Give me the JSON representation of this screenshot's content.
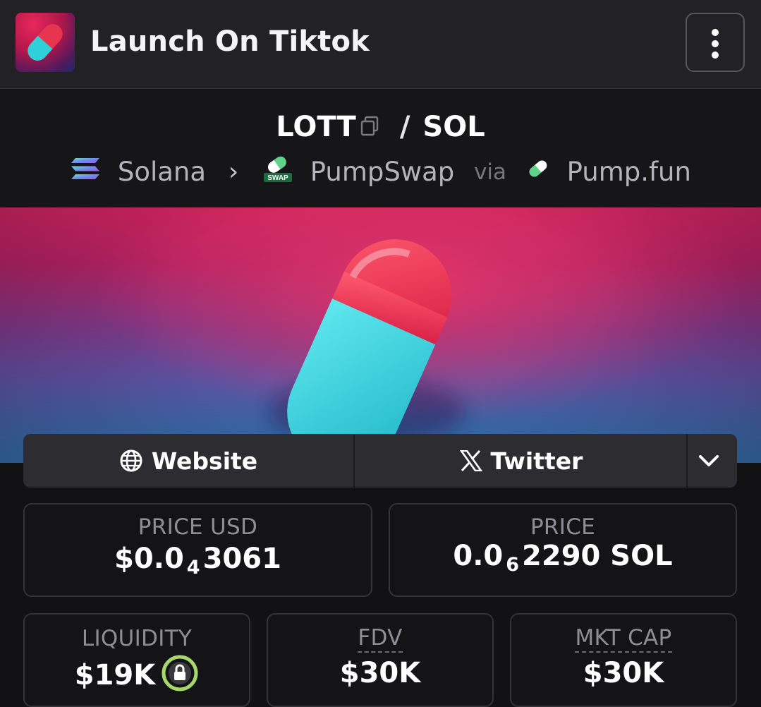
{
  "header": {
    "title": "Launch On Tiktok"
  },
  "pair": {
    "base": "LOTT",
    "separator": "/",
    "quote": "SOL",
    "chain": "Solana",
    "dex": "PumpSwap",
    "dex_badge": "SWAP",
    "via_label": "via",
    "launchpad": "Pump.fun"
  },
  "links": {
    "website_label": "Website",
    "twitter_label": "Twitter"
  },
  "stats": {
    "price_usd": {
      "label": "PRICE USD",
      "prefix": "$0.0",
      "zeros": "4",
      "digits": "3061"
    },
    "price_native": {
      "label": "PRICE",
      "prefix": "0.0",
      "zeros": "6",
      "digits": "2290",
      "unit": " SOL"
    },
    "liquidity": {
      "label": "LIQUIDITY",
      "value": "$19K"
    },
    "fdv": {
      "label": "FDV",
      "value": "$30K"
    },
    "mkt_cap": {
      "label": "MKT CAP",
      "value": "$30K"
    }
  },
  "colors": {
    "header_bg": "#222226",
    "page_bg": "#121214",
    "lock_ring": "#a6d86a",
    "pill_red": "#e8344f",
    "pill_cyan": "#2fd0d8"
  },
  "icons": [
    "app-logo",
    "vertical-dots-icon",
    "copy-icon",
    "solana-icon",
    "pumpswap-icon",
    "pumpfun-pill-icon",
    "globe-icon",
    "x-logo-icon",
    "chevron-down-icon",
    "lock-icon"
  ]
}
